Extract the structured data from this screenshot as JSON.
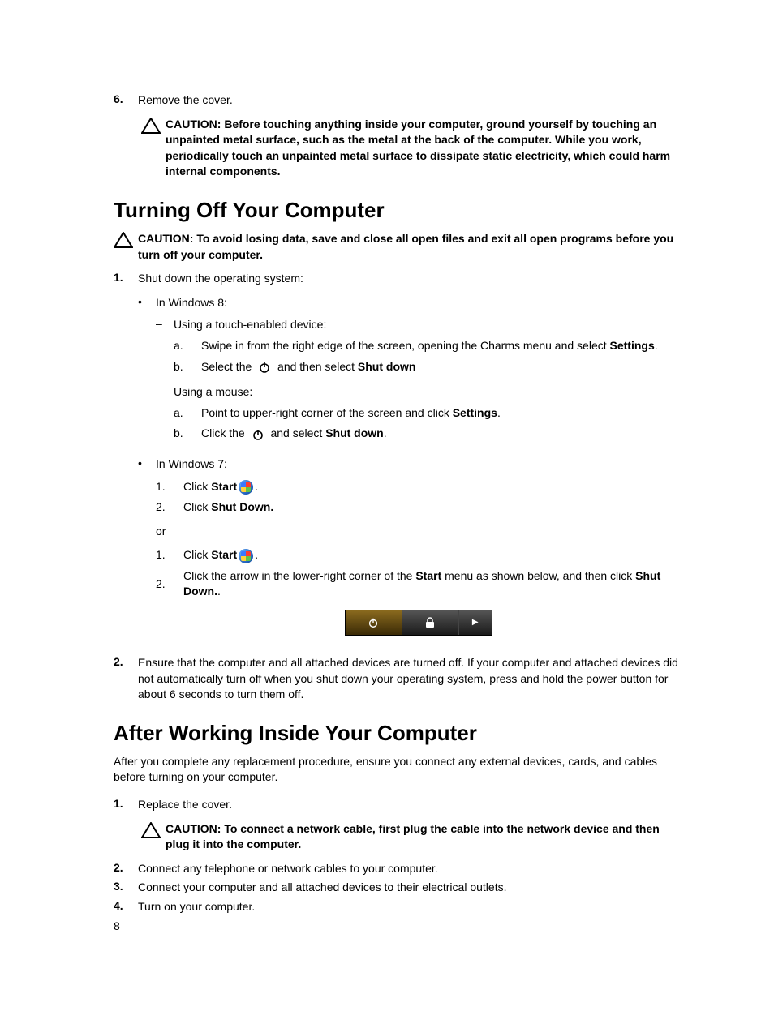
{
  "step6": {
    "num": "6.",
    "text": "Remove the cover."
  },
  "caution1": "CAUTION: Before touching anything inside your computer, ground yourself by touching an unpainted metal surface, such as the metal at the back of the computer. While you work, periodically touch an unpainted metal surface to dissipate static electricity, which could harm internal components.",
  "h1": "Turning Off Your Computer",
  "caution2": "CAUTION: To avoid losing data, save and close all open files and exit all open programs before you turn off your computer.",
  "turnoff_step1": {
    "num": "1.",
    "text": "Shut down the operating system:"
  },
  "win8_label": "In Windows 8:",
  "win8_touch_label": "Using a touch-enabled device:",
  "win8_touch_a": {
    "n": "a.",
    "pre": "Swipe in from the right edge of the screen, opening the Charms menu and select ",
    "bold": "Settings",
    "post": "."
  },
  "win8_touch_b": {
    "n": "b.",
    "pre": "Select the ",
    "mid": " and then select ",
    "bold": "Shut down"
  },
  "win8_mouse_label": "Using a mouse:",
  "win8_mouse_a": {
    "n": "a.",
    "pre": "Point to upper-right corner of the screen and click ",
    "bold": "Settings",
    "post": "."
  },
  "win8_mouse_b": {
    "n": "b.",
    "pre": "Click the ",
    "mid": " and select ",
    "bold": "Shut down",
    "post": "."
  },
  "win7_label": "In Windows 7:",
  "win7_1": {
    "n": "1.",
    "pre": "Click ",
    "bold": "Start",
    "post": "."
  },
  "win7_2": {
    "n": "2.",
    "pre": "Click ",
    "bold": "Shut Down."
  },
  "or": "or",
  "win7b_1": {
    "n": "1.",
    "pre": "Click ",
    "bold": "Start",
    "post": "."
  },
  "win7b_2": {
    "n": "2.",
    "pre": "Click the arrow in the lower-right corner of the ",
    "bold": "Start",
    "mid": " menu as shown below, and then click ",
    "bold2": "Shut Down.",
    "post": "."
  },
  "turnoff_step2": {
    "num": "2.",
    "text": "Ensure that the computer and all attached devices are turned off. If your computer and attached devices did not automatically turn off when you shut down your operating system, press and hold the power button for about 6 seconds to turn them off."
  },
  "h2": "After Working Inside Your Computer",
  "after_intro": "After you complete any replacement procedure, ensure you connect any external devices, cards, and cables before turning on your computer.",
  "after1": {
    "num": "1.",
    "text": "Replace the cover."
  },
  "caution3": "CAUTION: To connect a network cable, first plug the cable into the network device and then plug it into the computer.",
  "after2": {
    "num": "2.",
    "text": "Connect any telephone or network cables to your computer."
  },
  "after3": {
    "num": "3.",
    "text": "Connect your computer and all attached devices to their electrical outlets."
  },
  "after4": {
    "num": "4.",
    "text": "Turn on your computer."
  },
  "page": "8"
}
